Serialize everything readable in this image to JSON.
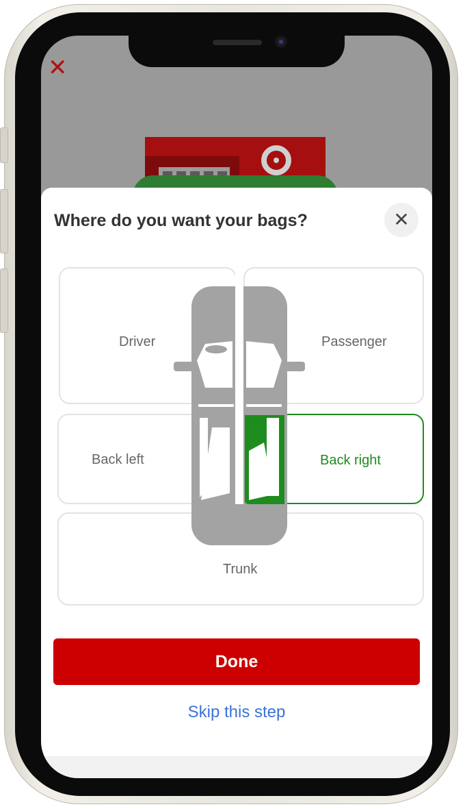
{
  "sheet": {
    "title": "Where do you want your bags?",
    "close_icon": "close-icon",
    "close_glyph": "✕"
  },
  "background": {
    "close_glyph": "✕",
    "close_color": "#b01010"
  },
  "zones": {
    "driver": {
      "label": "Driver",
      "selected": false
    },
    "passenger": {
      "label": "Passenger",
      "selected": false
    },
    "back_left": {
      "label": "Back left",
      "selected": false
    },
    "back_right": {
      "label": "Back right",
      "selected": true
    },
    "trunk": {
      "label": "Trunk",
      "selected": false
    }
  },
  "actions": {
    "done_label": "Done",
    "skip_label": "Skip this step"
  },
  "colors": {
    "accent": "#cc0000",
    "selected": "#1e8c1e",
    "link": "#3b73d6"
  }
}
